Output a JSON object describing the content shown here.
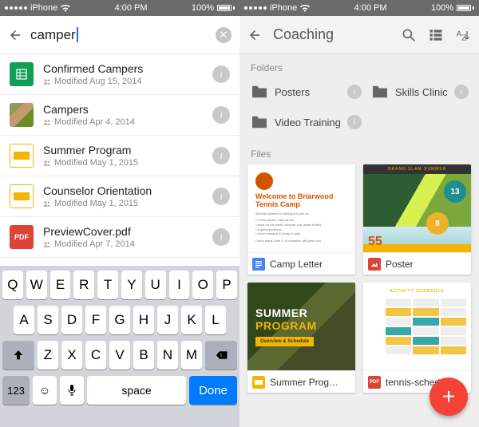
{
  "status": {
    "carrier": "iPhone",
    "time": "4:00 PM",
    "battery": "100%"
  },
  "left": {
    "search_query": "camper",
    "results": [
      {
        "title": "Confirmed Campers",
        "subtitle": "Modified Aug 15, 2014",
        "type": "sheets"
      },
      {
        "title": "Campers",
        "subtitle": "Modified Apr 4, 2014",
        "type": "photo"
      },
      {
        "title": "Summer Program",
        "subtitle": "Modified May 1, 2015",
        "type": "slides"
      },
      {
        "title": "Counselor Orientation",
        "subtitle": "Modified May 1, 2015",
        "type": "slides"
      },
      {
        "title": "PreviewCover.pdf",
        "subtitle": "Modified Apr 7, 2014",
        "type": "pdf"
      }
    ],
    "keyboard": {
      "row1": [
        "Q",
        "W",
        "E",
        "R",
        "T",
        "Y",
        "U",
        "I",
        "O",
        "P"
      ],
      "row2": [
        "A",
        "S",
        "D",
        "F",
        "G",
        "H",
        "J",
        "K",
        "L"
      ],
      "row3": [
        "Z",
        "X",
        "C",
        "V",
        "B",
        "N",
        "M"
      ],
      "num": "123",
      "space": "space",
      "done": "Done"
    }
  },
  "right": {
    "title": "Coaching",
    "folders_label": "Folders",
    "files_label": "Files",
    "folders": [
      {
        "name": "Posters"
      },
      {
        "name": "Skills Clinic"
      },
      {
        "name": "Video Training"
      }
    ],
    "files": [
      {
        "name": "Camp Letter",
        "type": "docs",
        "preview": {
          "heading": "Welcome to Briarwood Tennis Camp"
        }
      },
      {
        "name": "Poster",
        "type": "img",
        "preview": {
          "banner": "GRAND SLAM SUMMER",
          "badge1": "13",
          "badge2": "8",
          "num3": "55"
        }
      },
      {
        "name": "Summer Prog…",
        "type": "slides",
        "preview": {
          "line1": "SUMMER",
          "line2": "PROGRAM",
          "sub": "Overview & Schedule"
        }
      },
      {
        "name": "tennis-sched…",
        "type": "pdf",
        "preview": {
          "heading": "ACTIVITY SCHEDULE"
        }
      }
    ]
  }
}
